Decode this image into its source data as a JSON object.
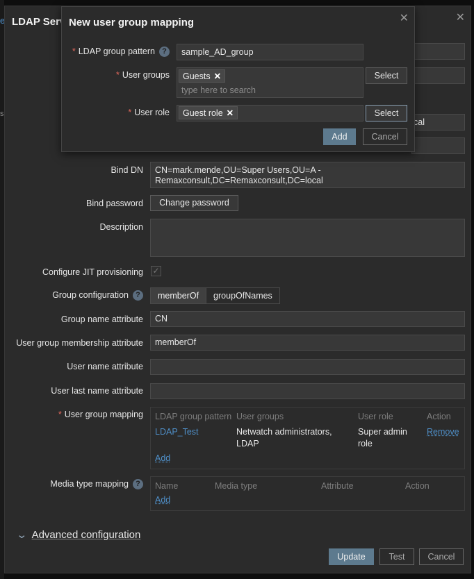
{
  "background": {
    "edge_text": "s:/",
    "edge_link": "e"
  },
  "main": {
    "title": "LDAP Serv",
    "hidden_field_fragment": "cal",
    "bind_dn": {
      "label": "Bind DN",
      "value_line1": "CN=mark.mende,OU=Super Users,OU=A -",
      "value_line2": "Remaxconsult,DC=Remaxconsult,DC=local"
    },
    "bind_password": {
      "label": "Bind password",
      "button": "Change password"
    },
    "description": {
      "label": "Description",
      "value": ""
    },
    "jit": {
      "label": "Configure JIT provisioning",
      "checked": true
    },
    "group_configuration": {
      "label": "Group configuration",
      "options": [
        "memberOf",
        "groupOfNames"
      ],
      "selected": "memberOf"
    },
    "group_name_attribute": {
      "label": "Group name attribute",
      "value": "CN"
    },
    "user_group_membership_attribute": {
      "label": "User group membership attribute",
      "value": "memberOf"
    },
    "user_name_attribute": {
      "label": "User name attribute",
      "value": ""
    },
    "user_last_name_attribute": {
      "label": "User last name attribute",
      "value": ""
    },
    "user_group_mapping": {
      "label": "User group mapping",
      "headers": [
        "LDAP group pattern",
        "User groups",
        "User role",
        "Action"
      ],
      "rows": [
        {
          "pattern": "LDAP_Test",
          "groups_line1": "Netwatch administrators,",
          "groups_line2": "LDAP",
          "role_line1": "Super admin",
          "role_line2": "role",
          "action": "Remove"
        }
      ],
      "add": "Add"
    },
    "media_type_mapping": {
      "label": "Media type mapping",
      "headers": [
        "Name",
        "Media type",
        "Attribute",
        "Action"
      ],
      "add": "Add"
    },
    "advanced": "Advanced configuration",
    "footer": {
      "update": "Update",
      "test": "Test",
      "cancel": "Cancel"
    }
  },
  "overlay": {
    "title": "New user group mapping",
    "pattern": {
      "label": "LDAP group pattern",
      "value": "sample_AD_group"
    },
    "user_groups": {
      "label": "User groups",
      "tags": [
        "Guests"
      ],
      "placeholder": "type here to search",
      "select": "Select"
    },
    "user_role": {
      "label": "User role",
      "tags": [
        "Guest role"
      ],
      "select": "Select"
    },
    "add": "Add",
    "cancel": "Cancel"
  },
  "colors": {
    "accent": "#5d7a8e",
    "link": "#4f8fc8",
    "required": "#e2685c"
  }
}
